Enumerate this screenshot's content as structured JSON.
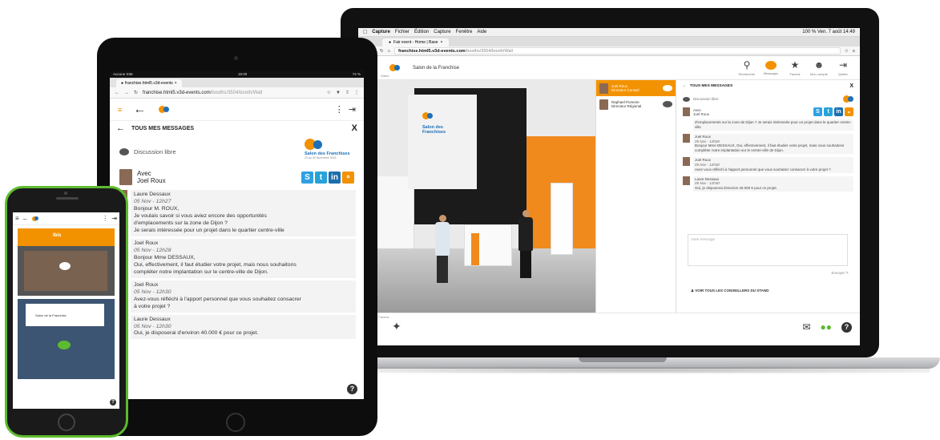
{
  "laptop": {
    "menubar": {
      "app": "Capture",
      "menus": [
        "Fichier",
        "Édition",
        "Capture",
        "Fenêtre",
        "Aide"
      ],
      "status": "100 % Ven. 7 août 14:49"
    },
    "browser_tab": "Fair event - Home | Base",
    "url": {
      "host": "franchise.html5.v3d-events.com",
      "path": "/booths/3504/booth/Wall"
    },
    "header": {
      "title": "Salon de la Franchise",
      "nav_labels": [
        "Retour",
        "Stand"
      ],
      "icons": [
        {
          "name": "search-icon",
          "label": "Rechercher"
        },
        {
          "name": "messages-icon",
          "label": "Messages"
        },
        {
          "name": "star-icon",
          "label": "Favoris"
        },
        {
          "name": "user-icon",
          "label": "Mon compte"
        },
        {
          "name": "logout-icon",
          "label": "Quitter"
        }
      ]
    },
    "contacts": [
      {
        "name": "Joel Roux",
        "role": "Directeur Conseil"
      },
      {
        "name": "Raphael Pomeire",
        "role": "Directeur Régional"
      }
    ],
    "chat": {
      "title": "TOUS MES MESSAGES",
      "close": "X",
      "discussion": "Discussion libre",
      "avec": "Avec",
      "contact_name": "Joel Roux",
      "messages": [
        {
          "author": "",
          "date": "",
          "text": "d'emplacements sur la zone de Dijon ? Je serais intéressée pour un projet dans le quartier centre-ville"
        },
        {
          "author": "Joel Roux",
          "date": "05 Nov - 12h28",
          "text": "Bonjour Mme DESSAUX, Oui, effectivement, il faut étudier votre projet, mais nous souhaitons compléter notre implantation sur le centre-ville de Dijon."
        },
        {
          "author": "Joel Roux",
          "date": "05 Nov - 12h30",
          "text": "Avez-vous réfléchi à l'apport personnel que vous souhaitez consacrer à votre projet ?"
        },
        {
          "author": "Laure Dessaux",
          "date": "05 Nov - 12h30",
          "text": "Oui, je disposerai d'environ 40.000 € pour ce projet."
        }
      ],
      "input_placeholder": "Votre message",
      "send": "Envoyer",
      "voir_tous": "VOIR TOUS LES CONSEILLERS DU STAND"
    },
    "bottom": {
      "left_label": "Ajouter aux Favoris",
      "right_labels": [
        "E-mail",
        "Dialoguer",
        "Aide"
      ]
    }
  },
  "tablet": {
    "status": {
      "carrier": "Aucune SIM",
      "time": "15:00",
      "battery": "74 %"
    },
    "tab": "franchise.html5.v3d-events",
    "url": {
      "host": "franchise.html5.v3d-events.com",
      "path": "/booths/3504/booth/Wall"
    },
    "chat": {
      "title": "TOUS MES MESSAGES",
      "close": "X",
      "discussion": "Discussion libre",
      "avec": "Avec",
      "contact_name": "Joel Roux",
      "messages": [
        {
          "author": "Laure Dessaux",
          "date": "05 Nov - 12h27",
          "lines": [
            "Bonjour M. ROUX,",
            "Je voulais savoir si vous aviez encore des opportunités",
            "d'emplacements sur la zone de Dijon ?",
            "Je serais intéressée pour un projet dans le quartier centre-ville"
          ]
        },
        {
          "author": "Joel Roux",
          "date": "05 Nov - 12h28",
          "lines": [
            "Bonjour Mme DESSAUX,",
            "Oui, effectivement, il faut étudier votre projet, mais nous souhaitons",
            "compléter notre implantation sur le centre-ville de Dijon."
          ]
        },
        {
          "author": "Joel Roux",
          "date": "05 Nov - 12h30",
          "lines": [
            "Avez-vous réfléchi à l'apport personnel que vous souhaitez consacrer",
            "à votre projet ?"
          ]
        },
        {
          "author": "Laure Dessaux",
          "date": "05 Nov - 12h30",
          "lines": [
            "Oui, je disposerai d'environ 40.000 € pour ce projet."
          ]
        }
      ]
    }
  },
  "phone": {
    "booth1_label": "Ibis",
    "booth2_label": "Salon de la Franchise"
  },
  "brand": {
    "logo_text": "Salon des Franchises",
    "logo_subtitle": "23 au 26 Novembre 2015",
    "colors": {
      "orange": "#f39200",
      "blue": "#1d6fb8",
      "green": "#5dbb2f"
    }
  }
}
